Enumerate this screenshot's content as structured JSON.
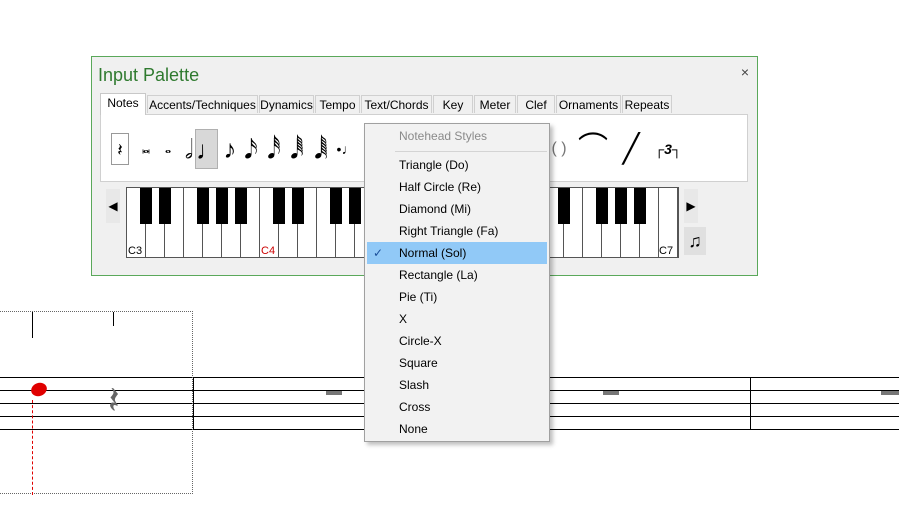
{
  "palette": {
    "title": "Input Palette",
    "close_glyph": "×",
    "tabs": [
      "Notes",
      "Accents/Techniques",
      "Dynamics",
      "Tempo",
      "Text/Chords",
      "Key",
      "Meter",
      "Clef",
      "Ornaments",
      "Repeats"
    ],
    "active_tab": "Notes",
    "tools": [
      {
        "name": "rest-tool",
        "glyph": "𝄽"
      },
      {
        "name": "double-whole-note-tool",
        "glyph": "𝅜"
      },
      {
        "name": "whole-note-tool",
        "glyph": "𝅝"
      },
      {
        "name": "half-note-tool",
        "glyph": "𝅗𝅥"
      },
      {
        "name": "quarter-note-tool",
        "glyph": "♩"
      },
      {
        "name": "eighth-note-tool",
        "glyph": "♪"
      },
      {
        "name": "sixteenth-note-tool",
        "glyph": "𝅘𝅥𝅯"
      },
      {
        "name": "thirty-second-note-tool",
        "glyph": "𝅘𝅥𝅰"
      },
      {
        "name": "sixty-fourth-note-tool",
        "glyph": "𝅘𝅥𝅱"
      },
      {
        "name": "one-twenty-eighth-note-tool",
        "glyph": "𝅘𝅥𝅲"
      },
      {
        "name": "dotted-note-tool",
        "glyph": "•♩"
      },
      {
        "name": "parentheses-tool",
        "glyph": "( )"
      },
      {
        "name": "tie-tool",
        "glyph": "⌒"
      },
      {
        "name": "slur-tool",
        "glyph": "╱"
      },
      {
        "name": "tuplet-tool",
        "glyph": "┌3┐"
      }
    ],
    "keyboard": {
      "labels": [
        "C3",
        "C4",
        "C7"
      ],
      "highlight_label": "C4",
      "left_arrow": "◀",
      "right_arrow": "▶"
    },
    "notehead_button_glyph": "♫"
  },
  "menu": {
    "header": "Notehead Styles",
    "items": [
      "Triangle (Do)",
      "Half Circle (Re)",
      "Diamond (Mi)",
      "Right Triangle (Fa)",
      "Normal (Sol)",
      "Rectangle (La)",
      "Pie (Ti)",
      "X",
      "Circle-X",
      "Square",
      "Slash",
      "Cross",
      "None"
    ],
    "checked_item": "Normal (Sol)",
    "check_glyph": "✓"
  },
  "score": {
    "rest_glyph": "𝄽"
  },
  "colors": {
    "palette_border": "#5aa85a",
    "palette_title": "#2f7a2f",
    "menu_highlight": "#91c9f7",
    "cursor": "#e00000",
    "keyboard_label_highlight": "#cc0000"
  }
}
